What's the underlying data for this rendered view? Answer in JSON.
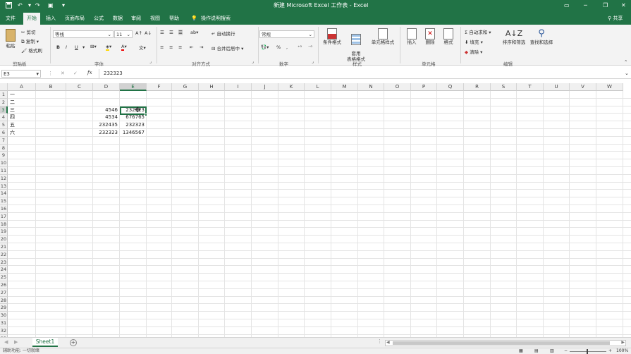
{
  "title": {
    "doc": "新建 Microsoft Excel 工作表 - Excel",
    "user_label": "共享"
  },
  "ribbon_tabs": [
    "文件",
    "开始",
    "插入",
    "页面布局",
    "公式",
    "数据",
    "审阅",
    "视图",
    "帮助"
  ],
  "tell_me": "操作说明搜索",
  "clipboard": {
    "paste": "粘贴",
    "cut": "剪切",
    "copy": "复制",
    "format_painter": "格式刷",
    "group": "剪贴板"
  },
  "font": {
    "name": "等线",
    "size": "11",
    "bold": "B",
    "italic": "I",
    "underline": "U",
    "group": "字体"
  },
  "alignment": {
    "wrap": "自动换行",
    "merge": "合并后居中",
    "group": "对齐方式"
  },
  "number": {
    "format": "常规",
    "percent": "%",
    "comma": ",",
    "group": "数字"
  },
  "styles": {
    "conditional": "条件格式",
    "table": "套用\n表格格式",
    "cell_styles": "单元格样式",
    "group": "样式"
  },
  "cells": {
    "insert": "插入",
    "delete": "删除",
    "format": "格式",
    "group": "单元格"
  },
  "editing": {
    "autosum": "自动求和",
    "fill": "填充",
    "clear": "清除",
    "sort": "排序和筛选",
    "find": "查找和选择",
    "group": "编辑"
  },
  "formula_bar": {
    "name_box": "E3",
    "fx": "fx",
    "value": "232323"
  },
  "columns": [
    "A",
    "B",
    "C",
    "D",
    "E",
    "F",
    "G",
    "H",
    "I",
    "J",
    "K",
    "L",
    "M",
    "N",
    "O",
    "P",
    "Q",
    "R",
    "S",
    "T",
    "U",
    "V",
    "W"
  ],
  "rows": [
    "1",
    "2",
    "3",
    "4",
    "5",
    "6",
    "7",
    "8",
    "9",
    "10",
    "11",
    "12",
    "13",
    "14",
    "15",
    "16",
    "17",
    "18",
    "19",
    "20",
    "21",
    "22",
    "23",
    "24",
    "25",
    "26",
    "27",
    "28",
    "29",
    "30",
    "31",
    "32",
    "33"
  ],
  "cells_data": {
    "A1": "一",
    "A2": "二",
    "A3": "三",
    "A4": "四",
    "A5": "五",
    "A6": "六",
    "D3": "4546",
    "D4": "4534",
    "D5": "232435",
    "D6": "232323",
    "E3": "232323",
    "E4": "676765",
    "E5": "232323",
    "E6": "1346567"
  },
  "active_cell": "E3",
  "sheet_tab": "Sheet1",
  "status": {
    "ready": "辅助功能: 一切就绪",
    "zoom": "100%"
  },
  "colors": {
    "excel_green": "#217346",
    "ribbon_bg": "#f3f3f3",
    "header_bg": "#f0f0f0"
  }
}
